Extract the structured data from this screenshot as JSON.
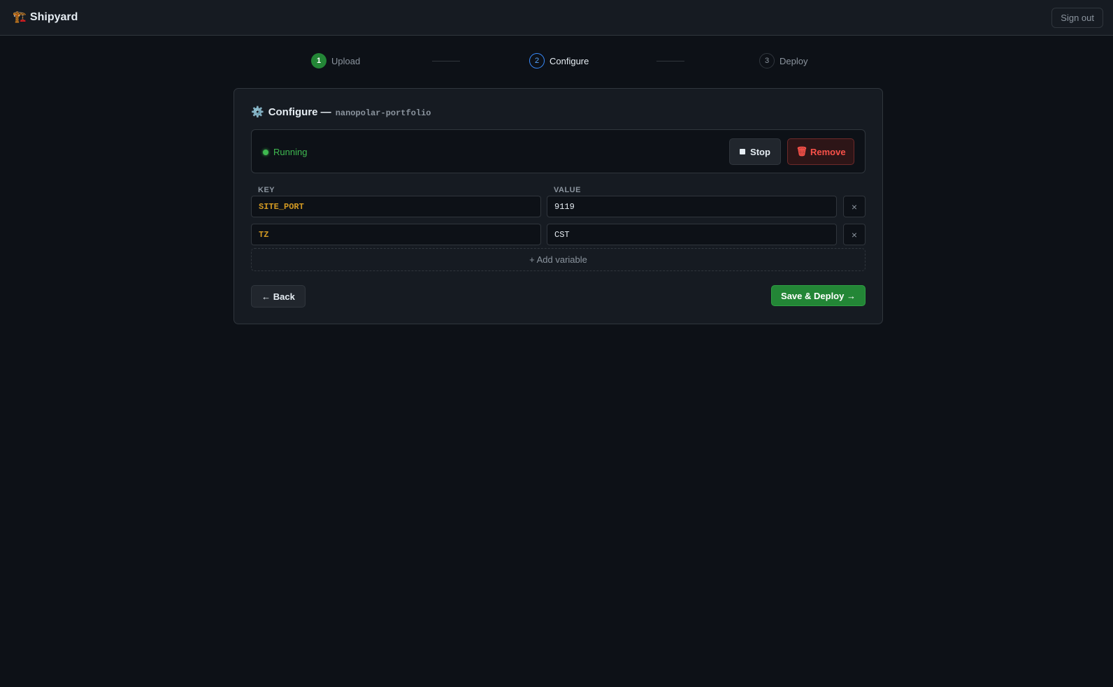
{
  "header": {
    "brand_icon": "🏗️",
    "brand_name": "Shipyard",
    "sign_out_label": "Sign out"
  },
  "stepper": {
    "steps": [
      {
        "number": "1",
        "label": "Upload",
        "state": "done"
      },
      {
        "number": "2",
        "label": "Configure",
        "state": "active"
      },
      {
        "number": "3",
        "label": "Deploy",
        "state": "todo"
      }
    ]
  },
  "card": {
    "title_icon": "⚙️",
    "title": "Configure —",
    "app_name": "nanopolar-portfolio",
    "status": {
      "label": "Running",
      "color": "#3fb950"
    },
    "stop_label": "Stop",
    "remove_icon": "🗑",
    "remove_label": "Remove",
    "columns": {
      "key": "KEY",
      "value": "VALUE"
    },
    "variables": [
      {
        "key": "SITE_PORT",
        "value": "9119"
      },
      {
        "key": "TZ",
        "value": "CST"
      }
    ],
    "delete_symbol": "×",
    "add_variable_label": "+ Add variable",
    "back_label": "← Back",
    "save_deploy_label": "Save & Deploy →"
  },
  "colors": {
    "background": "#0d1117",
    "panel": "#161b22",
    "accent_green": "#238636",
    "accent_blue": "#388bfd",
    "danger": "#f85149",
    "key_text": "#d29922"
  }
}
